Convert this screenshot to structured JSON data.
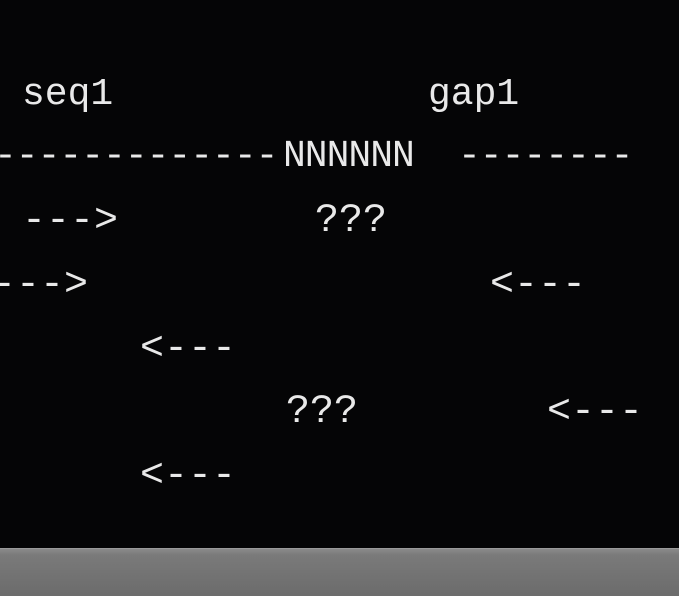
{
  "terminal": {
    "label_seq": "seq1",
    "label_gap": "gap1",
    "ruler_left": "-------------",
    "ruler_gap": "NNNNNN",
    "ruler_right": "--------",
    "row1_arrow": "--->",
    "row1_unknown": "???",
    "row2_arrow_left": "--->",
    "row2_arrow_right": "<---",
    "row3_arrow": "<---",
    "row4_unknown": "???",
    "row4_arrow": "<---",
    "row5_arrow": "<---"
  },
  "colors": {
    "background": "#050506",
    "text": "#e9e9e9",
    "bottom_bar": "#7a7a7a"
  }
}
